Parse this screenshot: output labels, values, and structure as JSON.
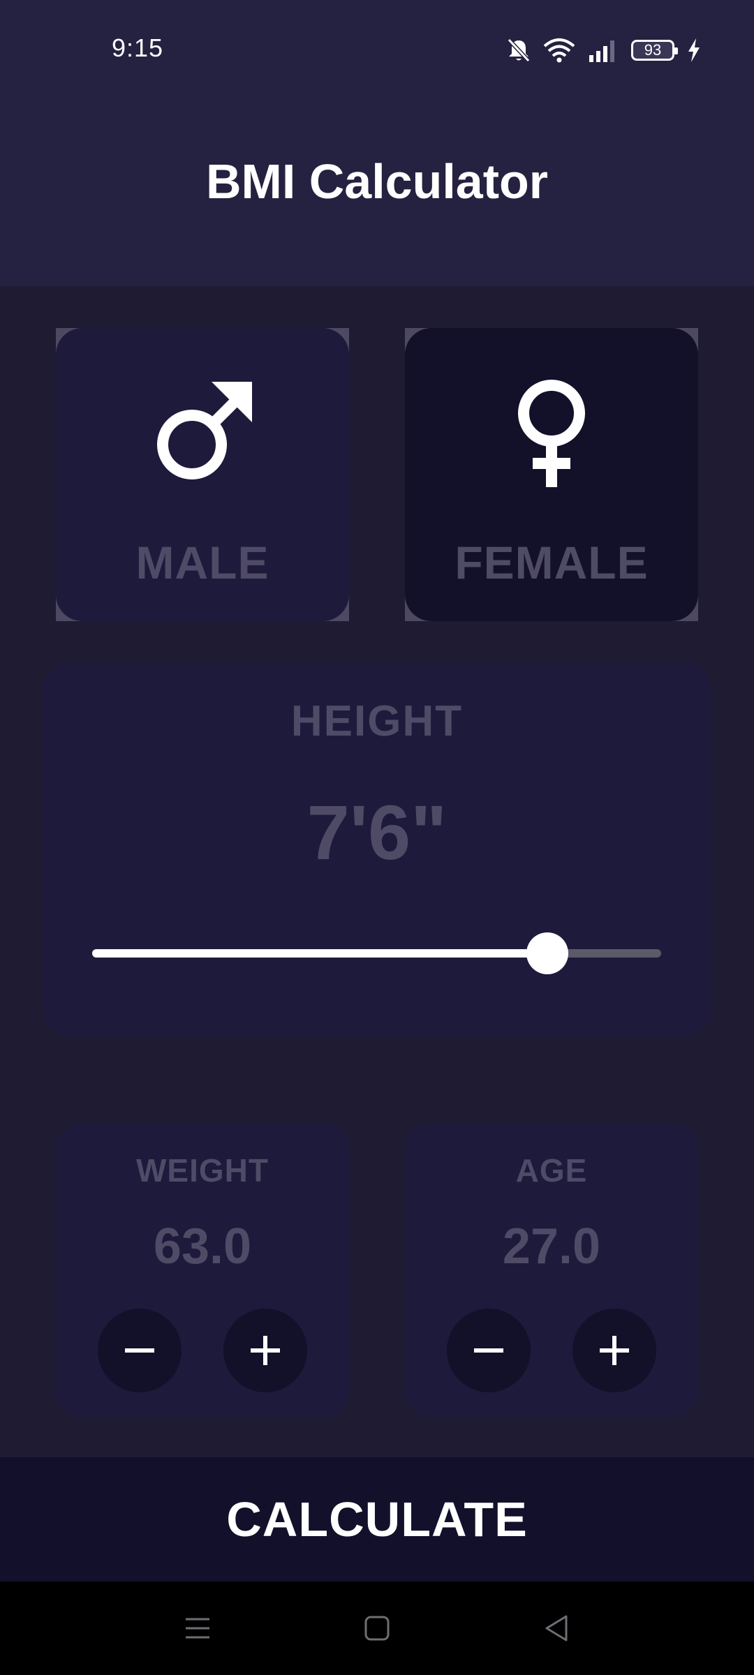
{
  "status_bar": {
    "time": "9:15",
    "battery_level": "93",
    "icons": [
      "bell-muted-icon",
      "wifi-icon",
      "signal-icon",
      "battery-icon",
      "charging-bolt-icon"
    ]
  },
  "app_bar": {
    "title": "BMI Calculator"
  },
  "gender": {
    "male": {
      "label": "MALE",
      "icon": "male-symbol-icon"
    },
    "female": {
      "label": "FEMALE",
      "icon": "female-symbol-icon"
    }
  },
  "height": {
    "label": "HEIGHT",
    "value": "7'6\"",
    "slider_fraction": 0.8
  },
  "weight": {
    "label": "WEIGHT",
    "value": "63.0",
    "buttons": [
      "minus-icon",
      "plus-icon"
    ]
  },
  "age": {
    "label": "AGE",
    "value": "27.0",
    "buttons": [
      "minus-icon",
      "plus-icon"
    ]
  },
  "calculate": {
    "label": "CALCULATE"
  },
  "nav_bar": {
    "icons": [
      "menu-icon",
      "home-square-icon",
      "back-triangle-icon"
    ]
  },
  "colors": {
    "background": "#1e1b33",
    "app_bar": "#252140",
    "active_card": "#1d1a3c",
    "inactive_card": "#13102a",
    "muted_text": "#4f4b66",
    "accent_white": "#ffffff"
  }
}
